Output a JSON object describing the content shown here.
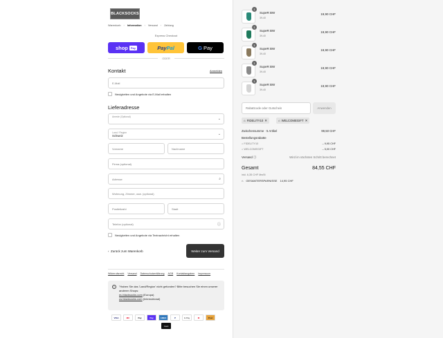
{
  "brand": {
    "logo_text": "BLACKSOCKS"
  },
  "breadcrumb": [
    "Warenkorb",
    "Information",
    "Versand",
    "Zahlung"
  ],
  "express": {
    "label": "Express Checkout",
    "shop_pay": "shop",
    "shop_pay_tag": "Pay",
    "paypal_a": "Pay",
    "paypal_b": "Pal",
    "gpay_g": "G",
    "gpay": "Pay",
    "separator": "ODER"
  },
  "contact": {
    "heading": "Kontakt",
    "login_link": "Anmelden",
    "email_placeholder": "E-Mail",
    "newsletter_label": "Neuigkeiten und Angebote via E-Mail erhalten"
  },
  "delivery": {
    "heading": "Lieferadresse",
    "salutation_label": "Anrede (Optional)",
    "country_label": "Land / Region",
    "country_value": "Schweiz",
    "firstname": "Vorname",
    "lastname": "Nachname",
    "company": "Firma (optional)",
    "address": "Adresse",
    "apartment": "Wohnung, Zimmer, usw. (optional)",
    "zip": "Postleitzahl",
    "city": "Stadt",
    "phone": "Telefon (optional)",
    "sms_label": "Neuigkeiten und Angebote via Textnachricht erhalten"
  },
  "nav": {
    "back": "Zurück zum Warenkorb",
    "next": "Weiter zum Versand"
  },
  "footer_links": [
    "Widerrufsrecht",
    "Versand",
    "Datenschutzerklärung",
    "AGB",
    "Kontaktangaben",
    "Impressum"
  ],
  "notice": {
    "text": "\"Haben Sie das 'Land/Region' nicht gefunden? Bitte besuchen Sie einen unserer anderen Shops:",
    "link1": "eu.blacksocks.com",
    "link1_suffix": " (Europa)",
    "link2": "us.blacksocks.com",
    "link2_suffix": " (International)"
  },
  "payment_icons": [
    "VISA",
    "MC",
    "Pay",
    "Pay",
    "AMEX",
    "P",
    "G Pay",
    "M",
    "Post",
    "Card"
  ],
  "cart": {
    "items": [
      {
        "qty": "1",
        "name": "SupeR BW",
        "size": "39-40",
        "price": "19,90 CHF",
        "color": "#2a8a78"
      },
      {
        "qty": "1",
        "name": "SupeR BW",
        "size": "39-40",
        "price": "19,90 CHF",
        "color": "#1f7a5c"
      },
      {
        "qty": "1",
        "name": "SupeR BW",
        "size": "39-40",
        "price": "19,90 CHF",
        "color": "#8a7a5e"
      },
      {
        "qty": "1",
        "name": "SupeR BW",
        "size": "39-40",
        "price": "19,90 CHF",
        "color": "#8a8a8a"
      },
      {
        "qty": "1",
        "name": "SupeR BW",
        "size": "39-40",
        "price": "19,90 CHF",
        "color": "#d4d4d4"
      }
    ],
    "discount_placeholder": "Rabattcode oder Gutschein",
    "apply": "Anwenden",
    "chips": [
      "FIDELITY10",
      "WELCOMEGIFT"
    ],
    "subtotal_label": "Zwischensumme · 5 Artikel",
    "subtotal": "99,50 CHF",
    "discounts_label": "Bestellungsrabatte",
    "discount1_label": "FIDELITY10",
    "discount1": "– 9,95 CHF",
    "discount2_label": "WELCOMEGIFT",
    "discount2": "– 5,00 CHF",
    "shipping_label": "Versand",
    "shipping_value": "Wird im nächsten Schritt berechnet",
    "total_label": "Gesamt",
    "total": "84,55 CHF",
    "vat": "inkl. 6,35 CHF MwSt",
    "savings_label": "GESAMTERSPARNISSE",
    "savings": "14,95 CHF"
  }
}
